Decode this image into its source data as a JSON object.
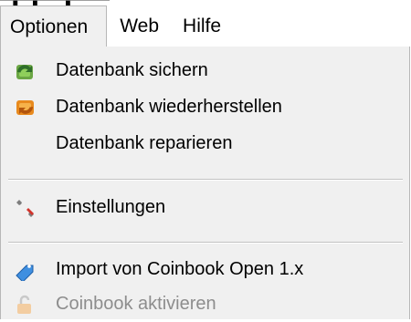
{
  "menubar": {
    "items": [
      {
        "label": "Optionen"
      },
      {
        "label": "Web"
      },
      {
        "label": "Hilfe"
      }
    ]
  },
  "menu": {
    "items": [
      {
        "label": "Datenbank sichern",
        "icon": "backup-icon",
        "enabled": true
      },
      {
        "label": "Datenbank wiederherstellen",
        "icon": "restore-icon",
        "enabled": true
      },
      {
        "label": "Datenbank reparieren",
        "icon": "",
        "enabled": true
      },
      {
        "label": "Einstellungen",
        "icon": "wrench-icon",
        "enabled": true
      },
      {
        "label": "Import von Coinbook Open 1.x",
        "icon": "tag-icon",
        "enabled": true
      },
      {
        "label": "Coinbook aktivieren",
        "icon": "lock-icon",
        "enabled": false
      }
    ]
  }
}
